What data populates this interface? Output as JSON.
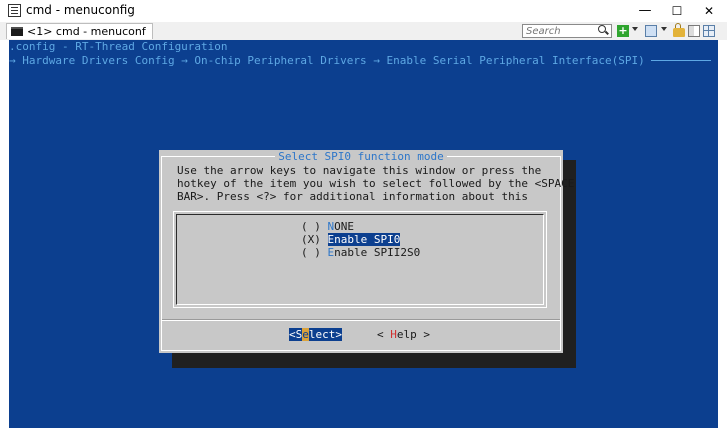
{
  "window": {
    "title": "cmd - menuconfig",
    "minimize": "—",
    "maximize": "☐",
    "close": "✕"
  },
  "tab": {
    "label": "<1> cmd - menuconf"
  },
  "toolbar": {
    "search_placeholder": "Search"
  },
  "console": {
    "line1": ".config - RT-Thread Configuration",
    "line2": "→ Hardware Drivers Config → On-chip Peripheral Drivers → Enable Serial Peripheral Interface(SPI)"
  },
  "dialog": {
    "title": "Select SPI0 function mode",
    "help": [
      "Use the arrow keys to navigate this window or press the",
      "hotkey of the item you wish to select followed by the <SPACE",
      "BAR>. Press <?> for additional information about this"
    ],
    "options": [
      {
        "mark": "( ) ",
        "hotkey": "N",
        "rest": "ONE",
        "selected": false
      },
      {
        "mark": "(X) ",
        "hotkey": "E",
        "rest": "nable SPI0",
        "selected": true
      },
      {
        "mark": "( ) ",
        "hotkey": "E",
        "rest": "nable SPII2S0",
        "selected": false
      }
    ],
    "buttons": {
      "select": {
        "left": "<",
        "pre": "S",
        "hotkey": "e",
        "post": "lect",
        "right": ">"
      },
      "help": {
        "left": "< ",
        "hotkey": "H",
        "post": "elp",
        "right": " >"
      }
    }
  },
  "colors": {
    "console_bg": "#0c3f8f",
    "console_fg": "#5ea8e4",
    "dialog_bg": "#c8c8c8",
    "hotkey": "#2d76c9",
    "help_hotkey": "#d03030",
    "button_hotkey_bg": "#d9a23c"
  }
}
